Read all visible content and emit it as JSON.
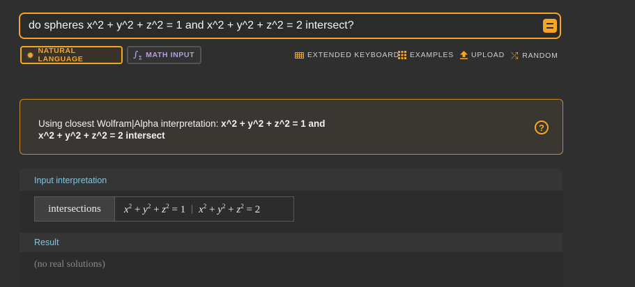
{
  "search": {
    "query": "do spheres x^2 + y^2 + z^2 = 1 and x^2 + y^2 + z^2 = 2 intersect?"
  },
  "modes": {
    "natural_language": "NATURAL LANGUAGE",
    "math_input": "MATH INPUT"
  },
  "toolbar": {
    "extended_keyboard": "EXTENDED KEYBOARD",
    "examples": "EXAMPLES",
    "upload": "UPLOAD",
    "random": "RANDOM"
  },
  "interpretation_notice": {
    "prefix": "Using closest Wolfram|Alpha interpretation: ",
    "line1_bold": "x^2 + y^2 + z^2 = 1 and",
    "line2_bold": "x^2 + y^2 + z^2 = 2 intersect"
  },
  "pods": {
    "input_interpretation": {
      "title": "Input interpretation",
      "operation": "intersections",
      "eq1_rhs": "1",
      "eq2_rhs": "2"
    },
    "result": {
      "title": "Result",
      "value": "(no real solutions)"
    }
  },
  "colors": {
    "accent": "#f6a623",
    "pod_title": "#7fc6e0",
    "math_input": "#b79de0"
  },
  "icons": {
    "compute": "equals-icon",
    "natural_language": "gear-sun-icon",
    "math_input": "integral-sigma-icon",
    "extended_keyboard": "keyboard-icon",
    "examples": "grid-dots-icon",
    "upload": "upload-arrow-icon",
    "random": "shuffle-icon",
    "help": "question-circle-icon"
  }
}
